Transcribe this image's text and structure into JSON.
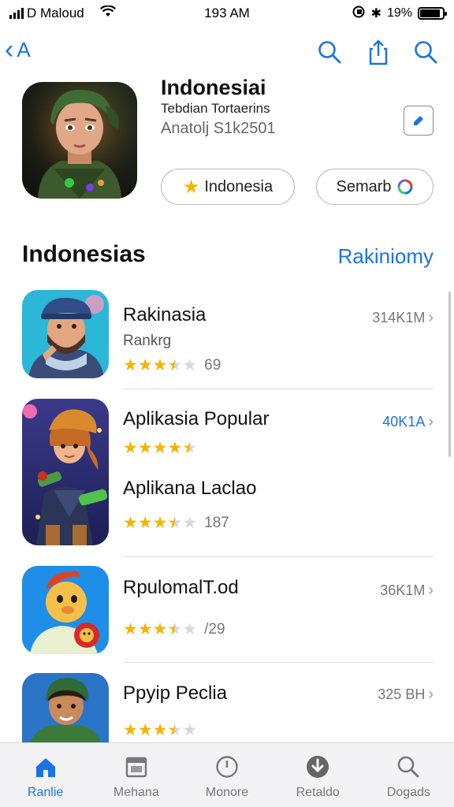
{
  "status_bar": {
    "carrier": "D Maloud",
    "time": "193 AM",
    "battery": "19%",
    "battery_level": 0.9
  },
  "nav": {
    "back_label": "A",
    "icons": [
      "search-icon",
      "share-icon",
      "search-icon"
    ]
  },
  "app": {
    "title": "Indonesiai",
    "subtitle": "Tebdian Tortaerins",
    "meta": "Anatolj S1k2501",
    "pill_primary": "Indonesia",
    "pill_secondary": "Semarb"
  },
  "section": {
    "title": "Indonesias",
    "link": "Rakiniomy"
  },
  "list": [
    {
      "title": "Rakinasia",
      "subtitle": "Rankrg",
      "rating": 3.5,
      "rating_count": "69",
      "price": "314K1M",
      "price_color": "#777777"
    },
    {
      "title": "Aplikasia Popular",
      "subtitle": "",
      "rating": 4.5,
      "rating_count": "",
      "price": "40K1A",
      "price_color": "#1a73e8"
    },
    {
      "title": "Aplikana Laclao",
      "subtitle": "",
      "rating": 3.5,
      "rating_count": "187",
      "price": "",
      "price_color": "#777777"
    },
    {
      "title": "RpulomalT.od",
      "subtitle": "",
      "rating": 3.5,
      "rating_count": "/29",
      "price": "36K1M",
      "price_color": "#777777"
    },
    {
      "title": "Ppyip Peclia",
      "subtitle": "",
      "rating": 3.5,
      "rating_count": "",
      "price": "325 BH",
      "price_color": "#777777"
    }
  ],
  "tabs": [
    {
      "label": "Ranlie",
      "icon": "home-icon",
      "active": true
    },
    {
      "label": "Mehana",
      "icon": "calendar-icon",
      "active": false
    },
    {
      "label": "Monore",
      "icon": "clock-icon",
      "active": false
    },
    {
      "label": "Retaldo",
      "icon": "download-icon",
      "active": false
    },
    {
      "label": "Dogads",
      "icon": "search-icon",
      "active": false
    }
  ]
}
